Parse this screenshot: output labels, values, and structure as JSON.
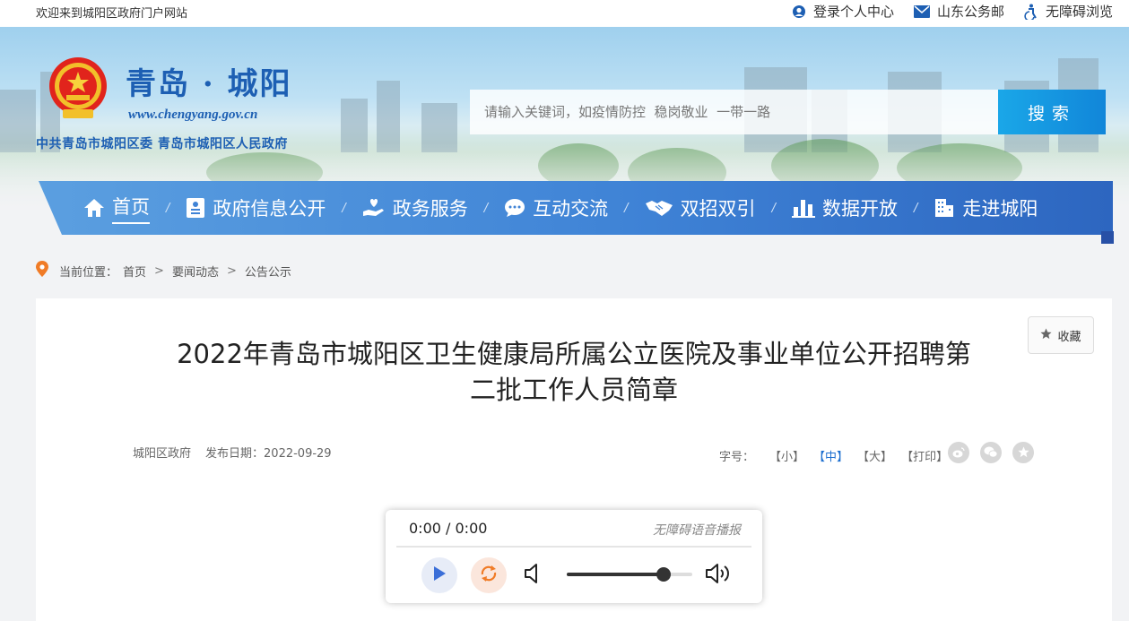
{
  "topbar": {
    "welcome": "欢迎来到城阳区政府门户网站",
    "links": [
      {
        "label": "登录个人中心",
        "icon": "user-icon"
      },
      {
        "label": "山东公务邮",
        "icon": "mail-icon"
      },
      {
        "label": "无障碍浏览",
        "icon": "accessibility-icon"
      }
    ]
  },
  "header": {
    "site_name": "青岛 · 城阳",
    "site_url": "www.chengyang.gov.cn",
    "site_sub": "中共青岛市城阳区委  青岛市城阳区人民政府",
    "search_placeholder": "请输入关键词，如疫情防控  稳岗敬业  一带一路",
    "search_button": "搜索"
  },
  "nav": {
    "items": [
      {
        "label": "首页",
        "icon": "home-icon",
        "active": true
      },
      {
        "label": "政府信息公开",
        "icon": "id-card-icon"
      },
      {
        "label": "政务服务",
        "icon": "hand-heart-icon"
      },
      {
        "label": "互动交流",
        "icon": "chat-icon"
      },
      {
        "label": "双招双引",
        "icon": "handshake-icon"
      },
      {
        "label": "数据开放",
        "icon": "bar-chart-icon"
      },
      {
        "label": "走进城阳",
        "icon": "building-icon"
      }
    ],
    "separator": "/"
  },
  "breadcrumb": {
    "prefix": "当前位置：",
    "items": [
      "首页",
      "要闻动态",
      "公告公示"
    ]
  },
  "article": {
    "favorite": "收藏",
    "title_line1": "2022年青岛市城阳区卫生健康局所属公立医院及事业单位公开招聘第",
    "title_line2": "二批工作人员简章",
    "source": "城阳区政府",
    "date_label": "发布日期：",
    "date": "2022-09-29",
    "fontsize_label": "字号：",
    "fontsize_options": [
      "【小】",
      "【中】",
      "【大】",
      "【打印】"
    ],
    "fontsize_selected": 1
  },
  "player": {
    "time": "0:00 / 0:00",
    "label": "无障碍语音播报",
    "volume": 0.77
  },
  "colors": {
    "brand_blue": "#1d5fb3",
    "search_button": "#1aa7e8",
    "nav_blue": "#3f83d6"
  }
}
